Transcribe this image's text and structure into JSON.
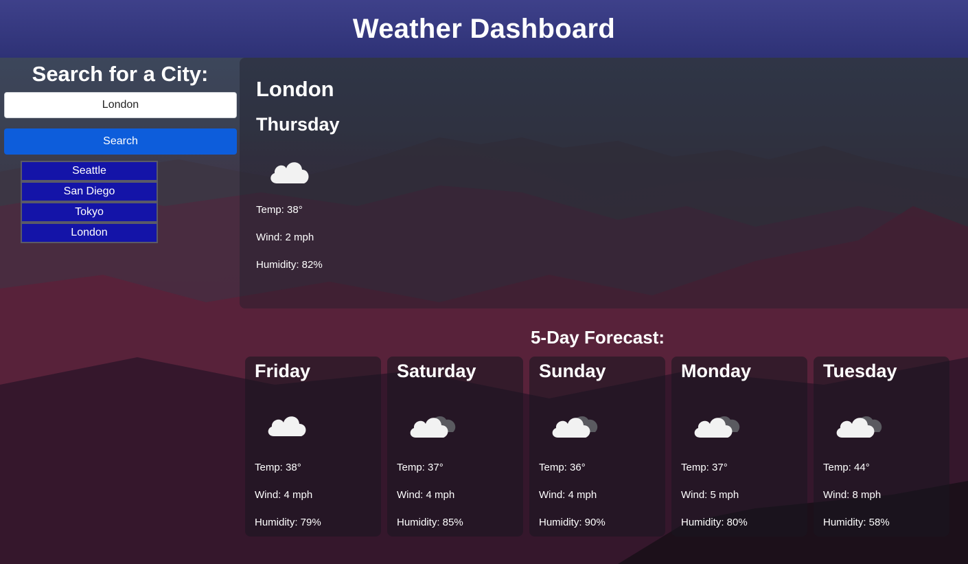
{
  "header": {
    "title": "Weather Dashboard"
  },
  "sidebar": {
    "heading": "Search for a City:",
    "search_value": "London",
    "search_button": "Search",
    "history": [
      "Seattle",
      "San Diego",
      "Tokyo",
      "London"
    ]
  },
  "current": {
    "city": "London",
    "day": "Thursday",
    "icon": "cloud-icon",
    "temp": "Temp: 38°",
    "wind": "Wind: 2 mph",
    "humidity": "Humidity: 82%"
  },
  "forecast": {
    "title": "5-Day Forecast:",
    "days": [
      {
        "day": "Friday",
        "icon": "cloud-icon",
        "temp": "Temp: 38°",
        "wind": "Wind: 4 mph",
        "humidity": "Humidity: 79%"
      },
      {
        "day": "Saturday",
        "icon": "broken-clouds-icon",
        "temp": "Temp: 37°",
        "wind": "Wind: 4 mph",
        "humidity": "Humidity: 85%"
      },
      {
        "day": "Sunday",
        "icon": "broken-clouds-icon",
        "temp": "Temp: 36°",
        "wind": "Wind: 4 mph",
        "humidity": "Humidity: 90%"
      },
      {
        "day": "Monday",
        "icon": "broken-clouds-icon",
        "temp": "Temp: 37°",
        "wind": "Wind: 5 mph",
        "humidity": "Humidity: 80%"
      },
      {
        "day": "Tuesday",
        "icon": "broken-clouds-icon",
        "temp": "Temp: 44°",
        "wind": "Wind: 8 mph",
        "humidity": "Humidity: 58%"
      }
    ]
  },
  "colors": {
    "header_bg": "#3e408c",
    "search_button": "#0d5ddb",
    "history_item": "#1414a8"
  }
}
